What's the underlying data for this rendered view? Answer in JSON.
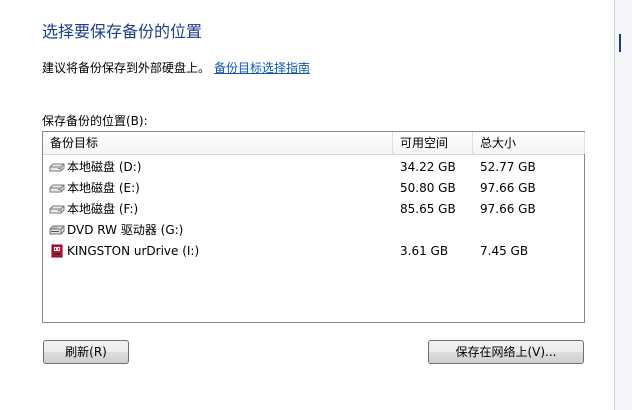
{
  "dialog": {
    "title": "选择要保存备份的位置",
    "intro_text": "建议将备份保存到外部硬盘上。",
    "intro_link": "备份目标选择指南",
    "list_label": "保存备份的位置(B):"
  },
  "columns": {
    "target": "备份目标",
    "free": "可用空间",
    "total": "总大小"
  },
  "rows": [
    {
      "name": "本地磁盘 (D:)",
      "free": "34.22 GB",
      "total": "52.77 GB",
      "icon": "hard-drive-icon"
    },
    {
      "name": "本地磁盘 (E:)",
      "free": "50.80 GB",
      "total": "97.66 GB",
      "icon": "hard-drive-icon"
    },
    {
      "name": "本地磁盘 (F:)",
      "free": "85.65 GB",
      "total": "97.66 GB",
      "icon": "hard-drive-icon"
    },
    {
      "name": "DVD RW 驱动器 (G:)",
      "free": "",
      "total": "",
      "icon": "dvd-drive-icon"
    },
    {
      "name": "KINGSTON urDrive (I:)",
      "free": "3.61 GB",
      "total": "7.45 GB",
      "icon": "usb-drive-icon"
    }
  ],
  "buttons": {
    "refresh": "刷新(R)",
    "save_network": "保存在网络上(V)..."
  },
  "colors": {
    "title": "#1a3d8f",
    "link": "#0a58b6"
  }
}
